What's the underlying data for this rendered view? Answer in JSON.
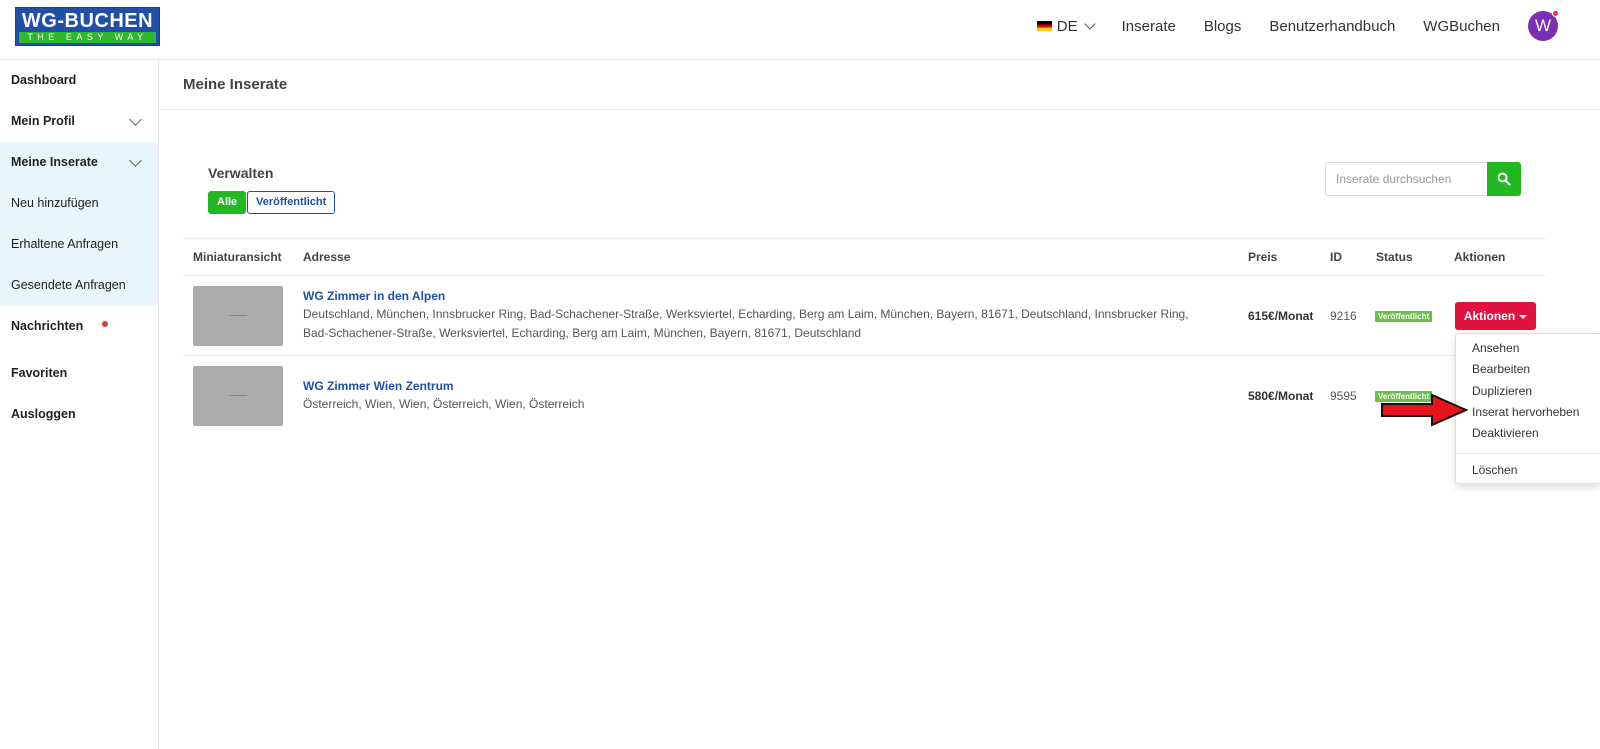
{
  "logo": {
    "top": "WG-BUCHEN",
    "bottom": "THE EASY WAY"
  },
  "nav": {
    "language": "DE",
    "links": [
      "Inserate",
      "Blogs",
      "Benutzerhandbuch",
      "WGBuchen"
    ],
    "avatar_initial": "W"
  },
  "sidebar": {
    "items": [
      {
        "label": "Dashboard"
      },
      {
        "label": "Mein Profil"
      },
      {
        "label": "Meine Inserate"
      },
      {
        "label": "Neu hinzufügen"
      },
      {
        "label": "Erhaltene Anfragen"
      },
      {
        "label": "Gesendete Anfragen"
      },
      {
        "label": "Nachrichten"
      },
      {
        "label": "Favoriten"
      },
      {
        "label": "Ausloggen"
      }
    ]
  },
  "page": {
    "title": "Meine Inserate",
    "manage_label": "Verwalten",
    "filters": [
      "Alle",
      "Veröffentlicht"
    ],
    "search_placeholder": "Inserate durchsuchen"
  },
  "table": {
    "headers": [
      "Miniaturansicht",
      "Adresse",
      "Preis",
      "ID",
      "Status",
      "Aktionen"
    ],
    "rows": [
      {
        "title": "WG Zimmer in den Alpen",
        "address": "Deutschland, München, Innsbrucker Ring, Bad-Schachener-Straße, Werksviertel, Echarding, Berg am Laim, München, Bayern, 81671, Deutschland, Innsbrucker Ring, Bad-Schachener-Straße, Werksviertel, Echarding, Berg am Laim, München, Bayern, 81671, Deutschland",
        "price": "615€/Monat",
        "id": "9216",
        "status": "Veröffentlicht"
      },
      {
        "title": "WG Zimmer Wien Zentrum",
        "address": "Österreich, Wien, Wien, Österreich, Wien, Österreich",
        "price": "580€/Monat",
        "id": "9595",
        "status": "Veröffentlicht"
      }
    ],
    "actions_button": "Aktionen"
  },
  "dropdown": {
    "items": [
      "Ansehen",
      "Bearbeiten",
      "Duplizieren",
      "Inserat hervorheben",
      "Deaktivieren",
      "Löschen"
    ]
  },
  "colors": {
    "brand_blue": "#1f4fa8",
    "green": "#22b822",
    "action_red": "#e0123f",
    "badge_green": "#6cc04a",
    "sidebar_active": "#e6f6fa"
  }
}
